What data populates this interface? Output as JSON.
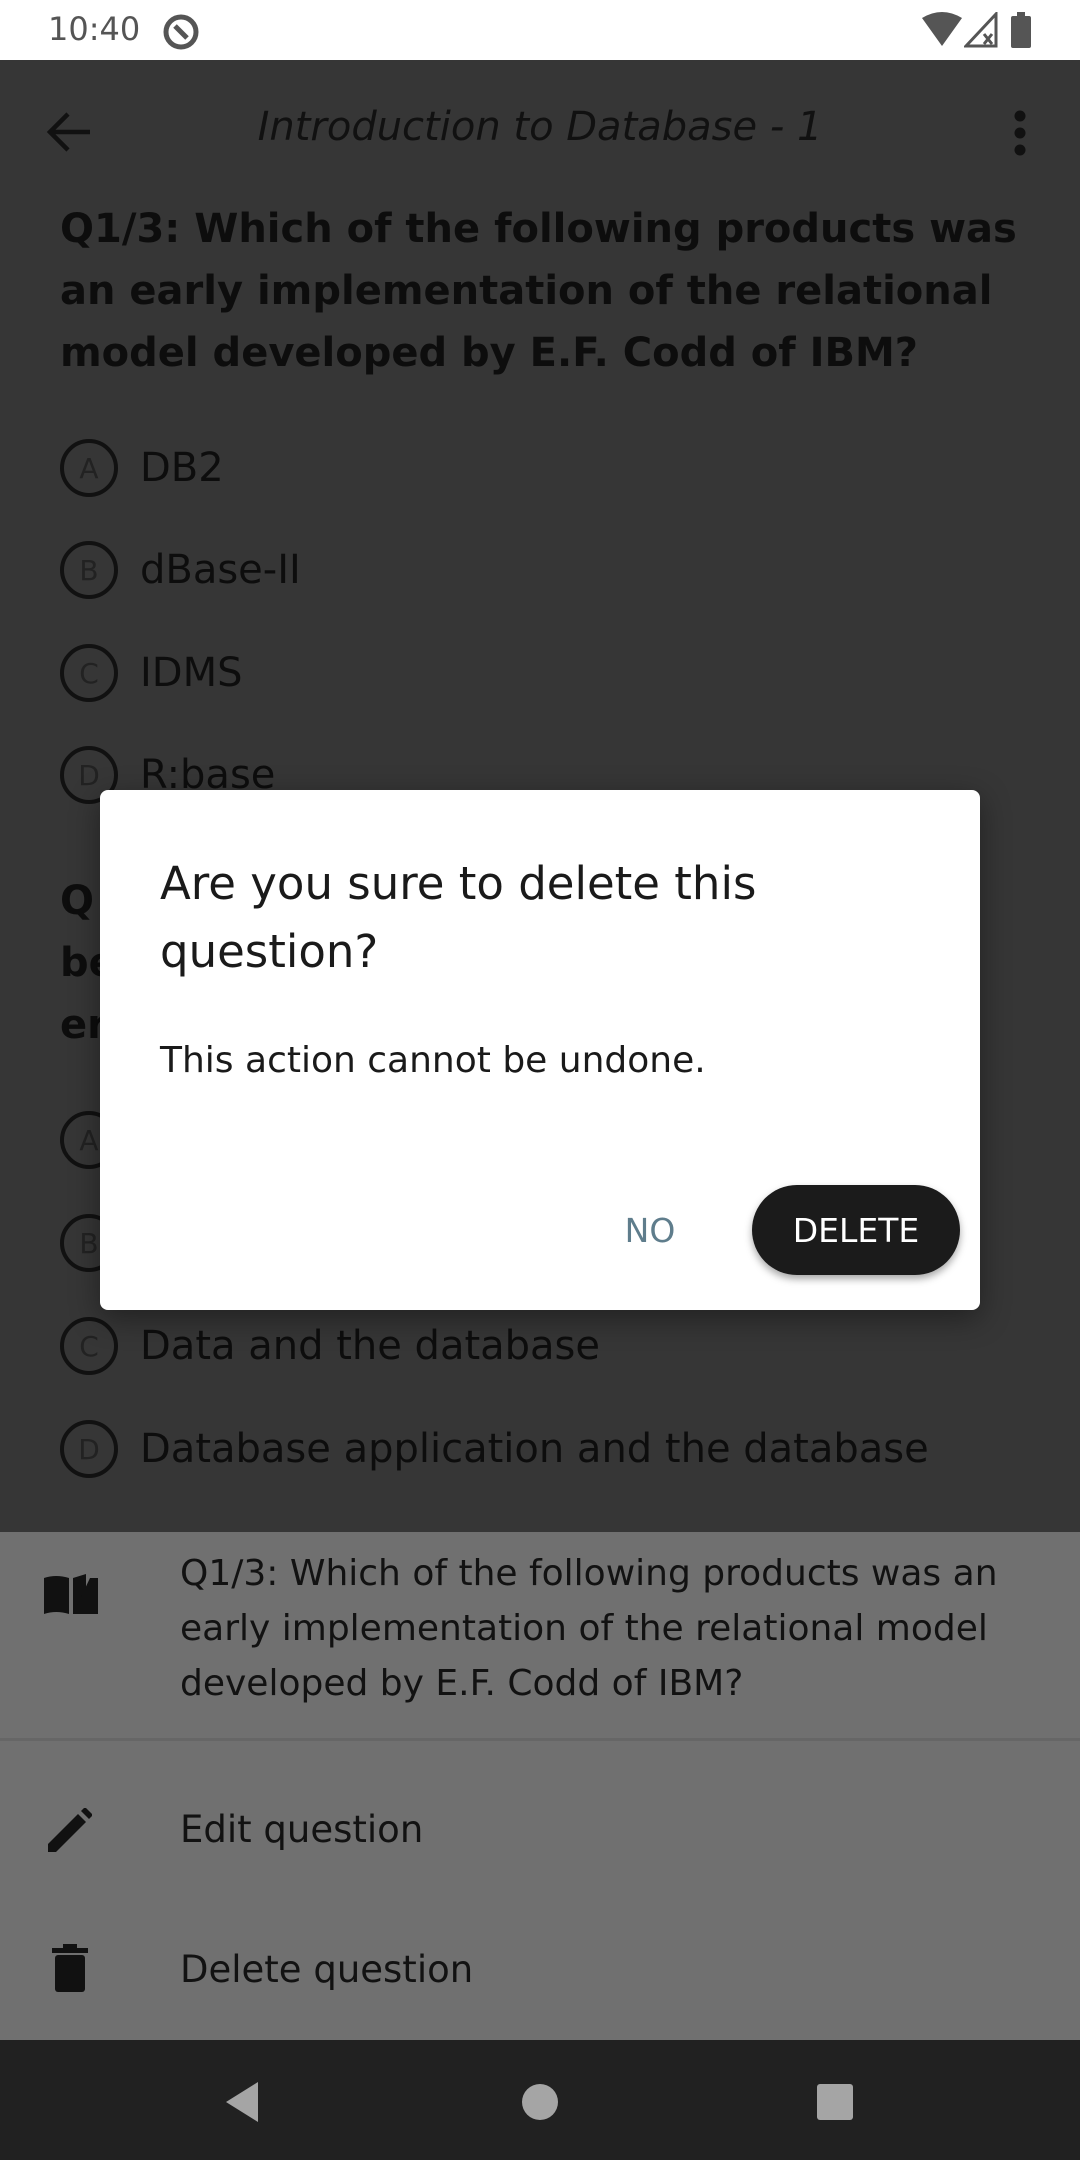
{
  "status": {
    "time": "10:40"
  },
  "toolbar": {
    "title": "Introduction to Database - 1"
  },
  "question1": {
    "text": "Q1/3:   Which of the following products was an early implementation of the relational model developed by E.F. Codd of IBM?",
    "options": [
      {
        "letter": "A",
        "text": "DB2"
      },
      {
        "letter": "B",
        "text": "dBase-II"
      },
      {
        "letter": "C",
        "text": "IDMS"
      },
      {
        "letter": "D",
        "text": "R:base"
      }
    ]
  },
  "question2": {
    "fragments": [
      "Q",
      "be",
      "er"
    ],
    "options": [
      {
        "letter": "A",
        "text": ""
      },
      {
        "letter": "B",
        "text": ""
      },
      {
        "letter": "C",
        "text": "Data and the database"
      },
      {
        "letter": "D",
        "text": "Database application and the database"
      }
    ]
  },
  "sheet": {
    "header": "Q1/3:   Which of the following products was an early implementation of the relational model developed by E.F. Codd of IBM?",
    "items": [
      {
        "label": "Edit question",
        "icon": "pencil-icon"
      },
      {
        "label": "Delete question",
        "icon": "trash-icon"
      }
    ]
  },
  "dialog": {
    "title": "Are you sure to delete this question?",
    "message": "This action cannot be undone.",
    "no_label": "NO",
    "delete_label": "DELETE"
  },
  "colors": {
    "dialog_no": "#5f7d8c",
    "delete_button": "#1b1b1b",
    "sheet_bg": "#707070"
  }
}
